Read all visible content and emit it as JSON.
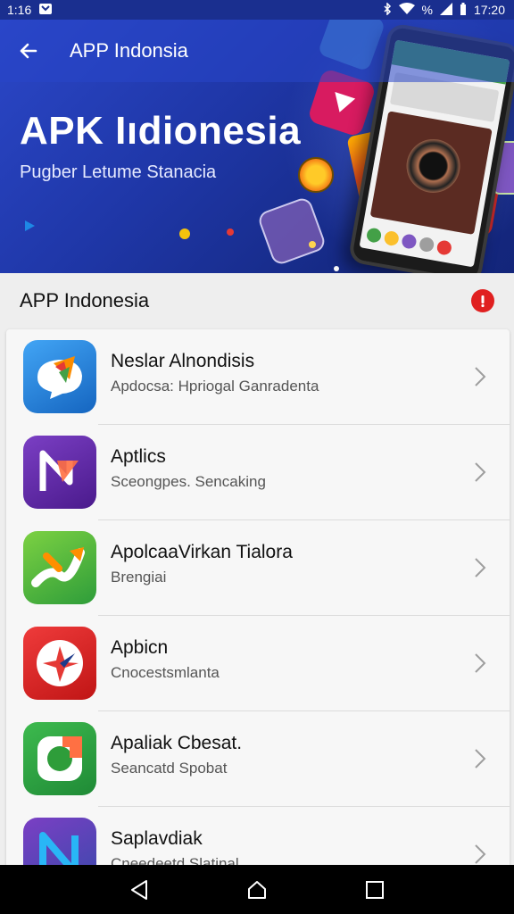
{
  "status_bar": {
    "time_left": "1:16 ",
    "battery": "%",
    "time_right": "17:20"
  },
  "app_bar": {
    "title": "APP Indonsia"
  },
  "hero": {
    "title": "APK Iıdionesia",
    "subtitle": "Pugber Letume Stanacia"
  },
  "section": {
    "title": "APP Indonesia"
  },
  "apps": [
    {
      "name": "Neslar Alnondisis",
      "desc": "Apdocsa: Hpriogal Ganradenta",
      "icon": "chat-bubble-icon",
      "color": "#1e88e5"
    },
    {
      "name": "Aptlics",
      "desc": "Sceongpes. Sencaking",
      "icon": "letter-n-icon",
      "color": "#6a2bb0"
    },
    {
      "name": "ApolcaaVirkan Tialora",
      "desc": "Brengiai",
      "icon": "arrow-icon",
      "color": "#4caf50"
    },
    {
      "name": "Apbicn",
      "desc": "Cnocestsmlanta",
      "icon": "star-compass-icon",
      "color": "#e53935"
    },
    {
      "name": "Apaliak Cbesat.",
      "desc": "Seancatd Spobat",
      "icon": "g-ring-icon",
      "color": "#43a047"
    },
    {
      "name": "Saplavdiak",
      "desc": "Cneedeetd Slatinal",
      "icon": "letter-n-icon",
      "color": "#5e35b1"
    }
  ],
  "nav": {
    "back": "back-icon",
    "home": "home-icon",
    "recents": "recents-icon"
  }
}
